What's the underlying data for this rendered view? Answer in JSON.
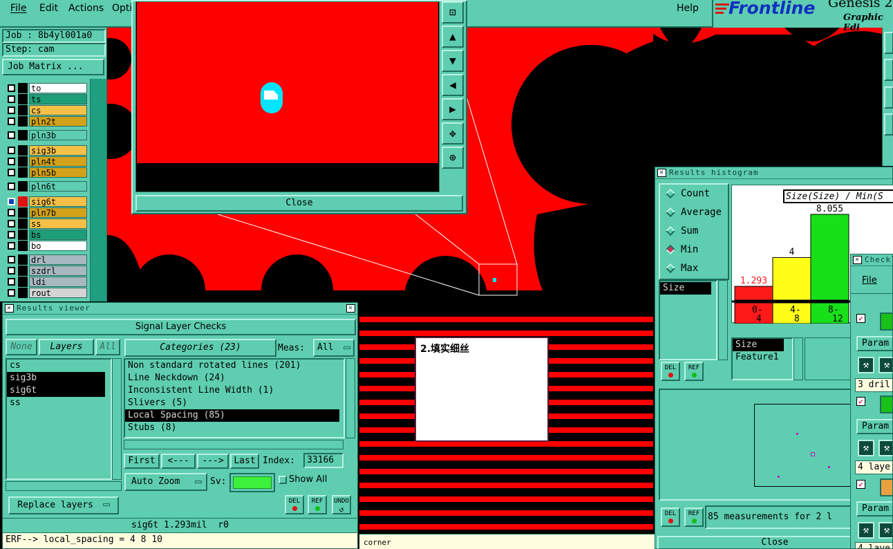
{
  "menu": {
    "file": "File",
    "edit": "Edit",
    "actions": "Actions",
    "options": "Opti",
    "help": "Help"
  },
  "brand": {
    "logo": "Frontline",
    "product": "Genesis 2",
    "subtitle": "Graphic Edi"
  },
  "job": {
    "job_label": "Job : 8b4yl001a0",
    "step_label": "Step: cam",
    "job_matrix": "Job Matrix ..."
  },
  "layers": [
    {
      "name": "to",
      "color": "#ffffff"
    },
    {
      "name": "ts",
      "color": "#1e9e78"
    },
    {
      "name": "cs",
      "color": "#f5c048"
    },
    {
      "name": "pln2t",
      "color": "#d4a21a"
    },
    {
      "name": "pln3b",
      "color": "#5ecdb0"
    },
    {
      "name": "sig3b",
      "color": "#f5c048"
    },
    {
      "name": "pln4t",
      "color": "#d4a21a"
    },
    {
      "name": "pln5b",
      "color": "#d4a21a"
    },
    {
      "name": "pln6t",
      "color": "#5ecdb0"
    },
    {
      "name": "sig6t",
      "color": "#f5c048"
    },
    {
      "name": "pln7b",
      "color": "#d4a21a"
    },
    {
      "name": "ss",
      "color": "#f5c048"
    },
    {
      "name": "bs",
      "color": "#1e9e78"
    },
    {
      "name": "bo",
      "color": "#ffffff"
    },
    {
      "name": "drl",
      "color": "#a8b8c0"
    },
    {
      "name": "szdrl",
      "color": "#a8b8c0"
    },
    {
      "name": "ldi",
      "color": "#a8b8c0"
    },
    {
      "name": "rout",
      "color": "#d4d4d4"
    }
  ],
  "zoom_window": {
    "close": "Close"
  },
  "results_viewer": {
    "title": "Results viewer",
    "header": "Signal Layer Checks",
    "none": "None",
    "layers": "Layers",
    "all": "All",
    "layer_list": [
      "cs",
      "sig3b",
      "sig6t",
      "ss"
    ],
    "categories": "Categories (23)",
    "meas_label": "Meas:",
    "meas_value": "All",
    "category_list": [
      "Non standard rotated lines (201)",
      "Line Neckdown (24)",
      "Inconsistent Line Width (1)",
      "Slivers (5)",
      "Local Spacing (85)",
      "Stubs (8)"
    ],
    "first": "First",
    "prev": "<---",
    "next": "--->",
    "last": "Last",
    "index_label": "Index:",
    "index_value": "33166",
    "auto_zoom": "Auto Zoom",
    "sv_label": "Sv:",
    "show_all": "Show All",
    "replace_layers": "Replace layers",
    "del": "DEL",
    "ref": "REF",
    "undo": "UNDO",
    "status": "sig6t 1.293mil  r0",
    "erf": "ERF--> local_spacing = 4 8 10"
  },
  "note": {
    "text": "2.填实细丝"
  },
  "corner_label": "corner",
  "histogram": {
    "title": "Results histogram",
    "radios": [
      "Count",
      "Average",
      "Sum",
      "Min",
      "Max"
    ],
    "selected": "Min",
    "chart_title": "Size(Size) / Min(S",
    "list1": [
      "Size"
    ],
    "list2": [
      "Size",
      "Feature1"
    ],
    "del": "DEL",
    "ref": "REF",
    "measurements": "85 measurements for 2 l",
    "close": "Close"
  },
  "chart_data": {
    "type": "bar",
    "categories": [
      "0-\n4",
      "4-\n8",
      "8-\n12"
    ],
    "values": [
      1.293,
      4,
      8.055
    ],
    "value_labels": [
      "1.293",
      "4",
      "8.055"
    ],
    "colors": [
      "#ff1a1a",
      "#ffff1a",
      "#18e018"
    ],
    "label_colors": [
      "#ff1a1a",
      "#000000",
      "#000000"
    ],
    "title": "Size(Size) / Min(S",
    "ylim": [
      0,
      8.055
    ]
  },
  "checklist": {
    "title": "Checkl",
    "file": "File",
    "param": "Param",
    "row1": "3 dril",
    "row2": "4 laye",
    "row3": "4 laye"
  }
}
